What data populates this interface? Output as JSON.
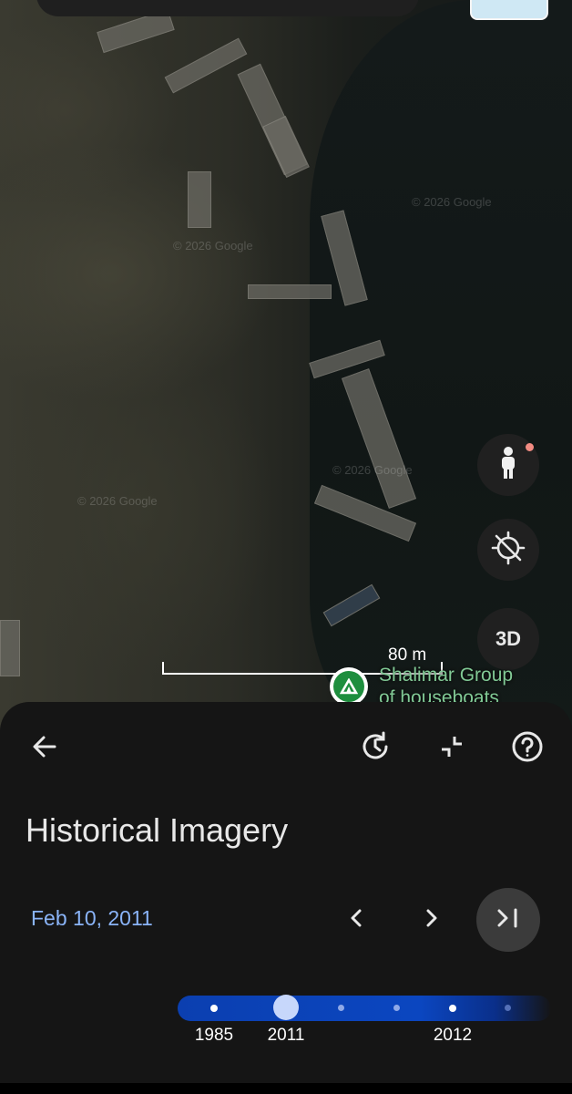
{
  "map": {
    "watermarks": [
      "© 2026 Google",
      "© 2026 Google",
      "© 2026 Google",
      "© 2026 Google"
    ],
    "scale": {
      "label": "80 m"
    },
    "poi": {
      "name_line1": "Shalimar Group",
      "name_line2": "of houseboats"
    },
    "buttons": {
      "three_d_label": "3D"
    },
    "icons": {
      "street_view": "pegman-icon",
      "location": "location-off-icon"
    },
    "colors": {
      "poi_text": "#81c995",
      "poi_marker": "#1e8e3e",
      "notification_dot": "#f28b82"
    }
  },
  "sheet": {
    "title": "Historical Imagery",
    "selected_date": "Feb 10, 2011",
    "toolbar_icons": [
      "back-arrow-icon",
      "history-icon",
      "collapse-icon",
      "help-icon"
    ],
    "nav_icons": [
      "previous-icon",
      "next-icon",
      "skip-to-latest-icon"
    ],
    "timeline": {
      "labels": [
        {
          "text": "1985"
        },
        {
          "text": "2011"
        },
        {
          "text": "2012"
        }
      ],
      "selected": "2011"
    },
    "colors": {
      "date_text": "#8ab4f8",
      "timeline": "#0b46c0",
      "selected_marker": "#c7d7fb"
    }
  }
}
